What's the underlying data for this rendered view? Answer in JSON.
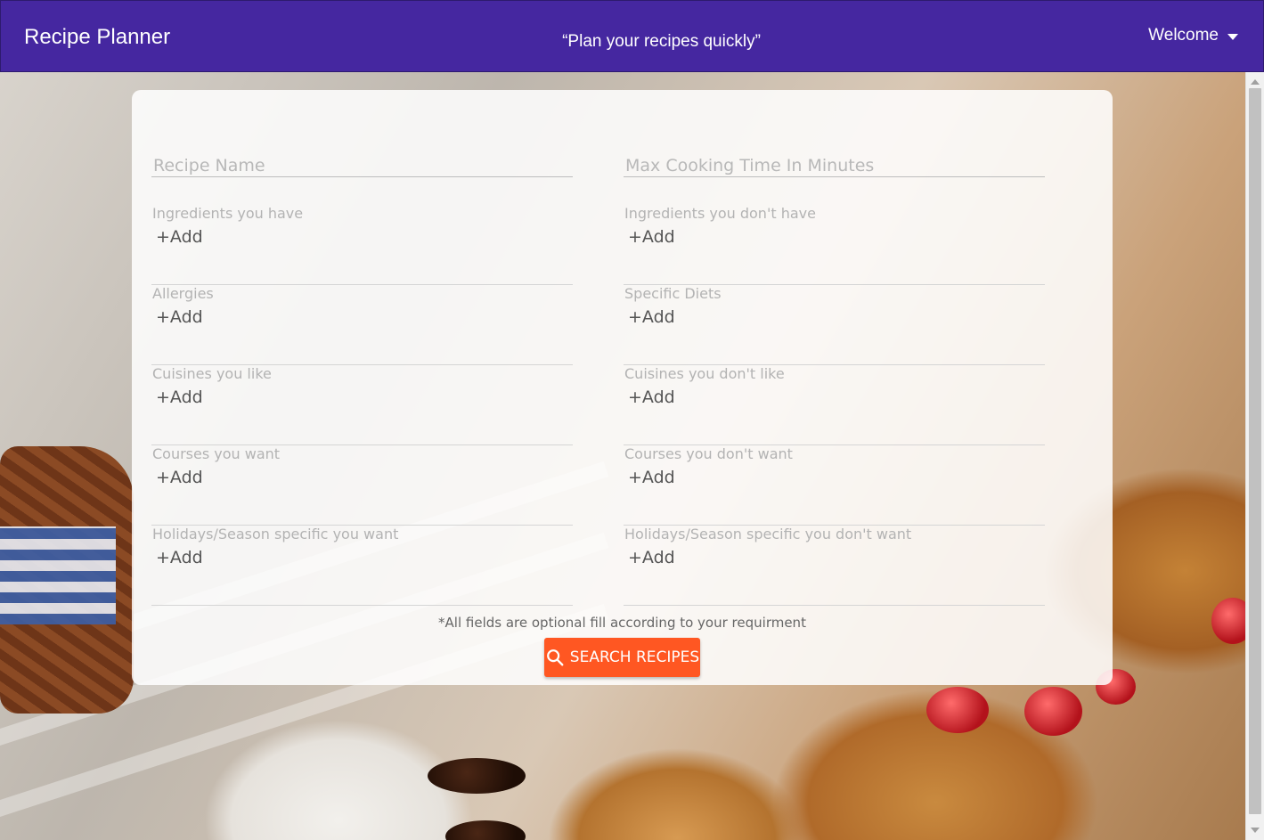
{
  "header": {
    "title": "Recipe Planner",
    "tagline": "“Plan your recipes quickly”",
    "user_menu_label": "Welcome"
  },
  "form": {
    "recipe_name_placeholder": "Recipe Name",
    "max_time_placeholder": "Max Cooking Time In Minutes",
    "groups": [
      {
        "label": "Ingredients you have",
        "add": "+Add"
      },
      {
        "label": "Ingredients you don't have",
        "add": "+Add"
      },
      {
        "label": "Allergies",
        "add": "+Add"
      },
      {
        "label": "Specific Diets",
        "add": "+Add"
      },
      {
        "label": "Cuisines you like",
        "add": "+Add"
      },
      {
        "label": "Cuisines you don't like",
        "add": "+Add"
      },
      {
        "label": "Courses you want",
        "add": "+Add"
      },
      {
        "label": "Courses you don't want",
        "add": "+Add"
      },
      {
        "label": "Holidays/Season specific you want",
        "add": "+Add"
      },
      {
        "label": "Holidays/Season specific you don't want",
        "add": "+Add"
      }
    ],
    "note": "*All fields are optional fill according to your requirment",
    "search_button": "SEARCH RECIPES"
  },
  "colors": {
    "header": "#4527a0",
    "button": "#ff5722"
  },
  "icons": {
    "user_menu": "caret-down-icon",
    "search": "search-icon"
  }
}
